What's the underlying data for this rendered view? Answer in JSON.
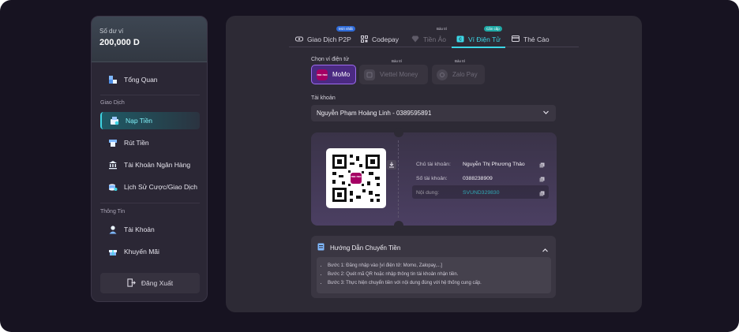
{
  "sidebar": {
    "balance_label": "Số dư ví",
    "balance_value": "200,000 D",
    "overview": "Tổng Quan",
    "group_trade": "Giao Dịch",
    "items": [
      {
        "label": "Nạp Tiền",
        "icon": "deposit-icon",
        "active": true
      },
      {
        "label": "Rút Tiền",
        "icon": "withdraw-icon"
      },
      {
        "label": "Tài Khoản Ngân Hàng",
        "icon": "bank-icon"
      },
      {
        "label": "Lịch Sử Cược/Giao Dịch",
        "icon": "history-icon"
      }
    ],
    "group_info": "Thông Tin",
    "info_items": [
      {
        "label": "Tài Khoản",
        "icon": "user-icon"
      },
      {
        "label": "Khuyến Mãi",
        "icon": "gift-icon"
      }
    ],
    "logout": "Đăng Xuất"
  },
  "tabs": [
    {
      "label": "Giao Dịch P2P",
      "badge": "Mới nhất"
    },
    {
      "label": "Codepay"
    },
    {
      "label": "Tiền Ảo",
      "badge": "Bảo trì"
    },
    {
      "label": "Ví Điện Tử",
      "badge": "Cân cấp"
    },
    {
      "label": "Thẻ Cào"
    }
  ],
  "wallet_section": {
    "label": "Chọn ví điện tử",
    "wallets": [
      {
        "label": "MoMo",
        "logo": "mo mo"
      },
      {
        "label": "Viettel Money",
        "badge": "Bảo trì"
      },
      {
        "label": "Zalo Pay",
        "badge": "Bảo trì"
      }
    ]
  },
  "account": {
    "label": "Tài khoản",
    "value": "Nguyễn Phạm Hoàng Linh - 0389595891"
  },
  "payment": {
    "qr_logo": "mo mo",
    "holder_label": "Chủ tài khoản:",
    "holder_value": "Nguyễn Thị Phương Thảo",
    "number_label": "Số tài khoản:",
    "number_value": "0388238909",
    "content_label": "Nội dung:",
    "content_value": "SVUND329830"
  },
  "guide": {
    "title": "Hướng Dẫn Chuyển Tiền",
    "steps": [
      "Bước 1: Đăng nhập vào [ví điện tử: Momo, Zalopay,...]",
      "Bước 2: Quét mã QR hoặc nhập thông tin tài khoản nhận tiền.",
      "Bước 3: Thực hiện chuyển tiền với nội dung đúng với hệ thống cung cấp."
    ]
  },
  "colors": {
    "accent": "#3cd7e6",
    "momo": "#a50064",
    "panel": "#2d2a35"
  }
}
